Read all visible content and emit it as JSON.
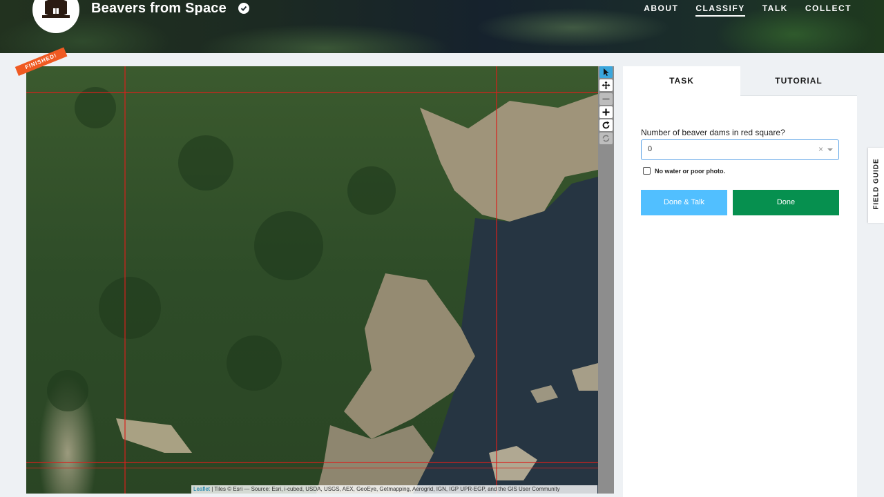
{
  "header": {
    "project_title": "Beavers from Space",
    "nav": [
      {
        "label": "ABOUT",
        "active": false
      },
      {
        "label": "CLASSIFY",
        "active": true
      },
      {
        "label": "TALK",
        "active": false
      },
      {
        "label": "COLLECT",
        "active": false
      }
    ],
    "icons": {
      "logo": "beaver-logo",
      "verified": "check-badge-icon"
    }
  },
  "map": {
    "badge": "FINISHED!",
    "attribution_link": "Leaflet",
    "attribution_text": " | Tiles © Esri — Source: Esri, i-cubed, USDA, USGS, AEX, GeoEye, Getmapping, Aerogrid, IGN, IGP UPR-EGP, and the GIS User Community",
    "grid_color": "#d9201c"
  },
  "toolbar": {
    "tools": [
      "pointer-icon",
      "pan-icon",
      "zoom-out-icon",
      "zoom-in-icon",
      "rotate-icon",
      "reset-icon"
    ]
  },
  "panel": {
    "tabs": {
      "task": "TASK",
      "tutorial": "TUTORIAL"
    },
    "question": "Number of beaver dams in red square?",
    "select_value": "0",
    "select_clear": "×",
    "checkbox_label": "No water or poor photo.",
    "done_talk_label": "Done & Talk",
    "done_label": "Done"
  },
  "field_guide_label": "FIELD GUIDE",
  "colors": {
    "accent_blue": "#51bfff",
    "done_green": "#06904f",
    "ribbon": "#f05a22"
  }
}
